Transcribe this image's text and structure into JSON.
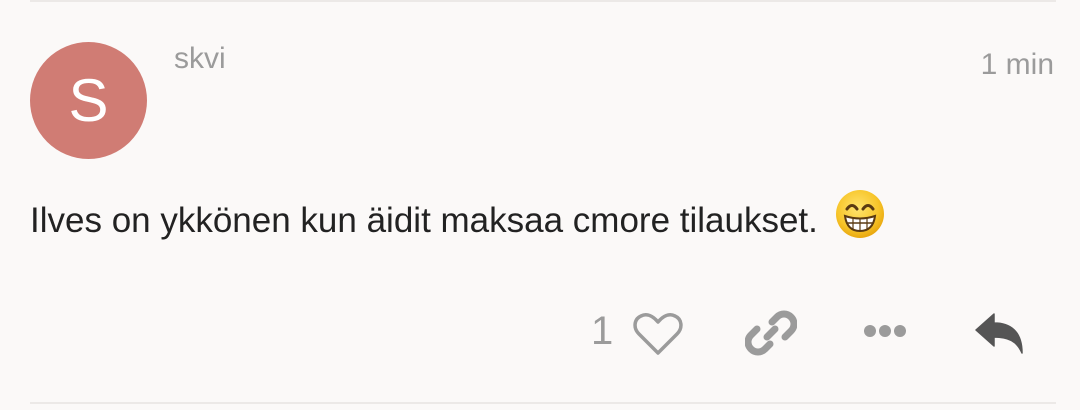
{
  "post": {
    "avatar_letter": "S",
    "username": "skvi",
    "timestamp": "1 min",
    "body": "Ilves on ykkönen kun äidit maksaa cmore tilaukset.",
    "emoji": "grinning-face-with-smiling-eyes"
  },
  "actions": {
    "like_count": "1",
    "like_icon": "heart-outline-icon",
    "link_icon": "link-icon",
    "more_icon": "ellipsis-icon",
    "reply_icon": "reply-icon"
  },
  "colors": {
    "avatar_bg": "#d07c74",
    "muted_text": "#9b9b9b",
    "body_text": "#222222",
    "reply_icon": "#555555",
    "background": "#fbf9f8"
  }
}
